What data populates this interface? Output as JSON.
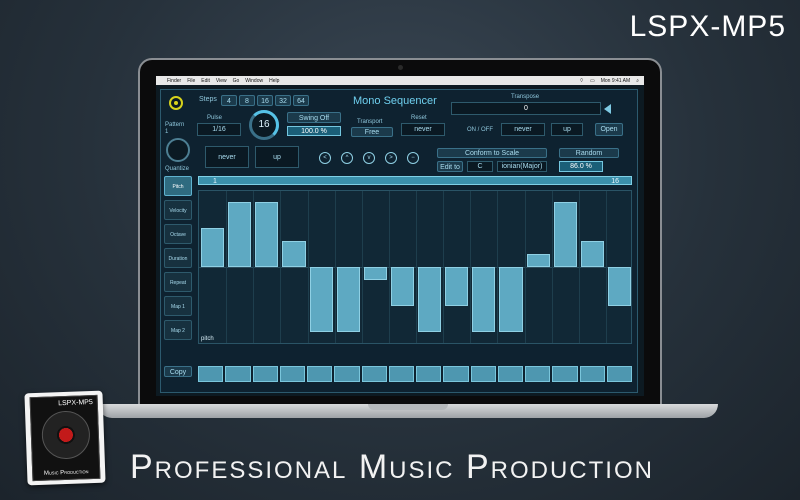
{
  "brand": {
    "title": "LSPX-MP5",
    "tagline": "Professional Music Production"
  },
  "product_box": {
    "name": "LSPX-MP5",
    "tag": "Music Production"
  },
  "menubar": {
    "items": [
      "Finder",
      "File",
      "Edit",
      "View",
      "Go",
      "Window",
      "Help"
    ],
    "clock": "Mon 9:41 AM"
  },
  "app": {
    "title": "Mono Sequencer",
    "pattern_label": "Pattern",
    "pattern_value": "1",
    "steps_label": "Steps",
    "steps_options": [
      "4",
      "8",
      "16",
      "32",
      "64"
    ],
    "pulse_label": "Pulse",
    "pulse_value": "1/16",
    "dial_value": "16",
    "swing_label": "Swing Off",
    "swing_percent": "100.0 %",
    "transport_label": "Transport",
    "transport_value": "Free",
    "reset_label": "Reset",
    "reset_value": "never",
    "transpose_label": "Transpose",
    "transpose_value": "0",
    "on_off_label": "ON / OFF",
    "on_off_value": "never",
    "direction_value": "up",
    "open_label": "Open",
    "quantize_label": "Quantize",
    "row2_never": "never",
    "row2_up": "up",
    "conform_label": "Conform to Scale",
    "edit_to_label": "Edit to",
    "key_value": "C",
    "scale_value": "ionian(Major)",
    "random_label": "Random",
    "random_percent": "86.0 %",
    "ruler_start": "1",
    "ruler_end": "16",
    "grid_label": "pitch",
    "copy_label": "Copy",
    "sidebar": [
      "Pitch",
      "Velocity",
      "Octave",
      "Duration",
      "Repeat",
      "Map 1",
      "Map 2"
    ],
    "pitch_steps": [
      3,
      5,
      5,
      2,
      -5,
      -5,
      -1,
      -3,
      -5,
      -3,
      -5,
      -5,
      1,
      5,
      2,
      -3
    ]
  }
}
